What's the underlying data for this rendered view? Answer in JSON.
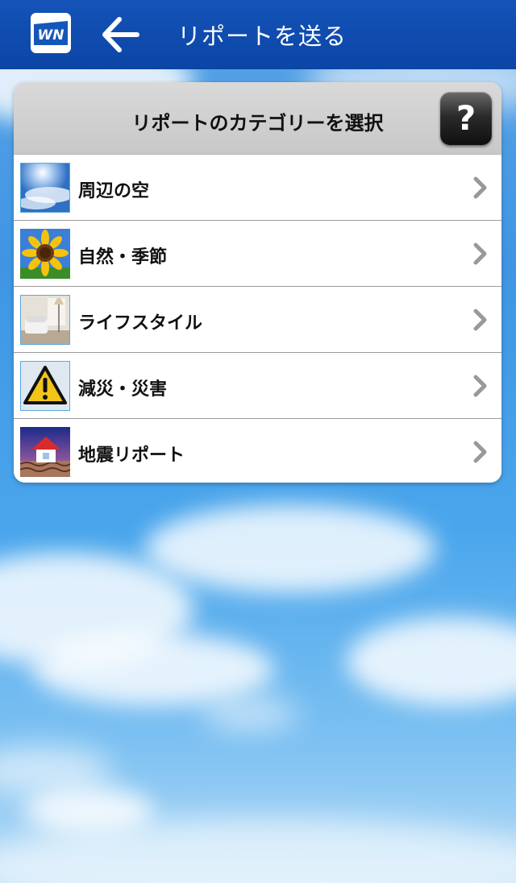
{
  "header": {
    "title": "リポートを送る",
    "logo_icon": "wni-logo-icon",
    "back_icon": "back-arrow-icon",
    "bar_color": "#0e49aa"
  },
  "panel": {
    "title": "リポートのカテゴリーを選択",
    "help_label": "?",
    "categories": [
      {
        "label": "周辺の空",
        "icon": "sky-photo-icon"
      },
      {
        "label": "自然・季節",
        "icon": "sunflower-photo-icon"
      },
      {
        "label": "ライフスタイル",
        "icon": "living-room-photo-icon"
      },
      {
        "label": "減災・災害",
        "icon": "warning-icon"
      },
      {
        "label": "地震リポート",
        "icon": "earthquake-house-icon"
      }
    ]
  }
}
